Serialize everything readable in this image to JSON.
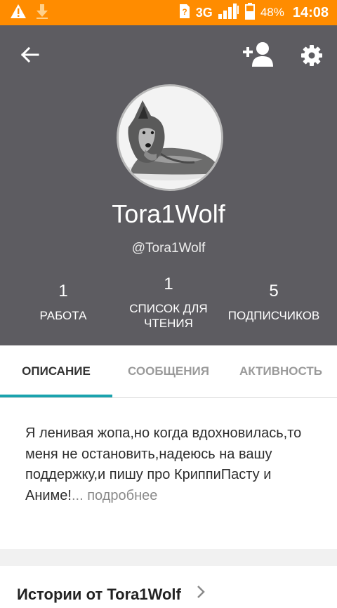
{
  "status_bar": {
    "network": "3G",
    "battery": "48%",
    "time": "14:08",
    "icons": [
      "warning-icon",
      "download-icon",
      "sim-icon",
      "signal-icon",
      "battery-icon"
    ]
  },
  "profile": {
    "name": "Tora1Wolf",
    "handle": "@Tora1Wolf",
    "stats": [
      {
        "value": "1",
        "label": "РАБОТА"
      },
      {
        "value": "1",
        "label": "СПИСОК ДЛЯ ЧТЕНИЯ"
      },
      {
        "value": "5",
        "label": "ПОДПИСЧИКОВ"
      }
    ]
  },
  "tabs": [
    {
      "label": "ОПИСАНИЕ",
      "active": true
    },
    {
      "label": "СООБЩЕНИЯ",
      "active": false
    },
    {
      "label": "АКТИВНОСТЬ",
      "active": false
    }
  ],
  "description": {
    "text": "Я ленивая жопа,но когда вдохновилась,то меня не остановить,надеюсь на вашу поддержку,и пишу про КриппиПасту и Аниме!",
    "more": "... подробнее"
  },
  "stories": {
    "title": "Истории от Tora1Wolf"
  },
  "colors": {
    "status_bar": "#ff8c00",
    "header": "#5d5c61",
    "accent": "#1aa3ae"
  }
}
